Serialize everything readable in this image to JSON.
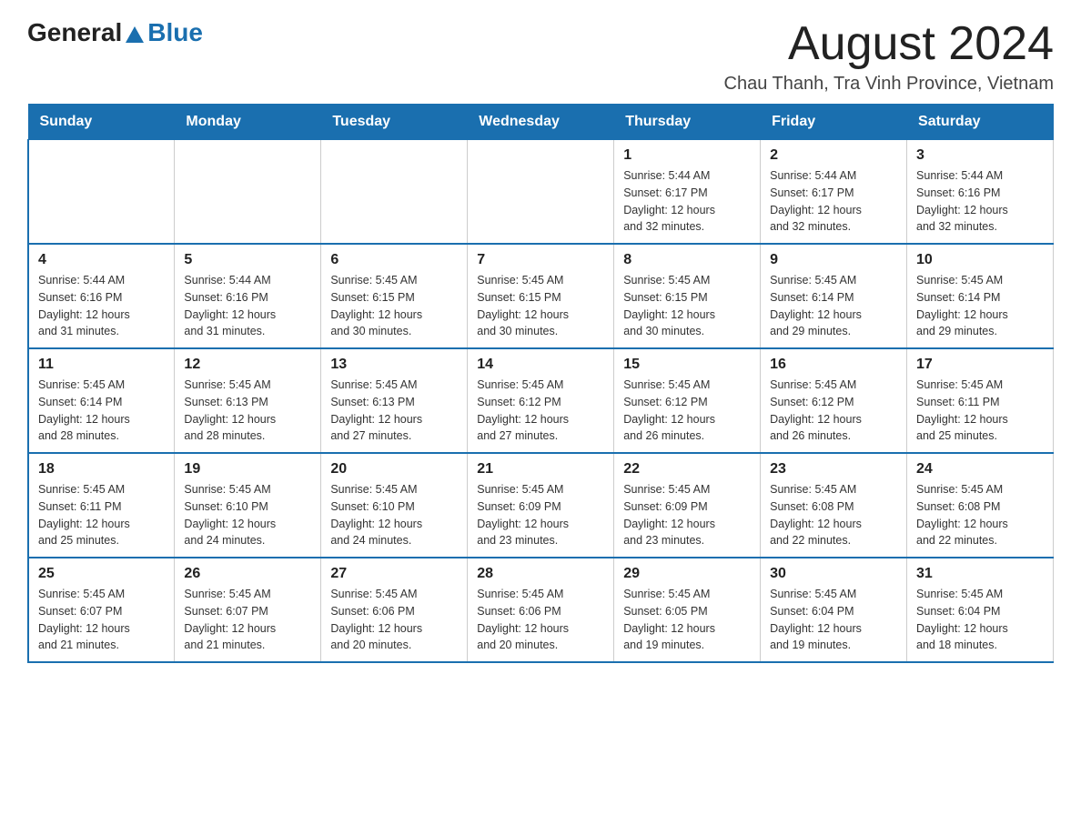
{
  "header": {
    "logo_general": "General",
    "logo_blue": "Blue",
    "title": "August 2024",
    "subtitle": "Chau Thanh, Tra Vinh Province, Vietnam"
  },
  "days_of_week": [
    "Sunday",
    "Monday",
    "Tuesday",
    "Wednesday",
    "Thursday",
    "Friday",
    "Saturday"
  ],
  "weeks": [
    {
      "days": [
        {
          "number": "",
          "info": ""
        },
        {
          "number": "",
          "info": ""
        },
        {
          "number": "",
          "info": ""
        },
        {
          "number": "",
          "info": ""
        },
        {
          "number": "1",
          "info": "Sunrise: 5:44 AM\nSunset: 6:17 PM\nDaylight: 12 hours\nand 32 minutes."
        },
        {
          "number": "2",
          "info": "Sunrise: 5:44 AM\nSunset: 6:17 PM\nDaylight: 12 hours\nand 32 minutes."
        },
        {
          "number": "3",
          "info": "Sunrise: 5:44 AM\nSunset: 6:16 PM\nDaylight: 12 hours\nand 32 minutes."
        }
      ]
    },
    {
      "days": [
        {
          "number": "4",
          "info": "Sunrise: 5:44 AM\nSunset: 6:16 PM\nDaylight: 12 hours\nand 31 minutes."
        },
        {
          "number": "5",
          "info": "Sunrise: 5:44 AM\nSunset: 6:16 PM\nDaylight: 12 hours\nand 31 minutes."
        },
        {
          "number": "6",
          "info": "Sunrise: 5:45 AM\nSunset: 6:15 PM\nDaylight: 12 hours\nand 30 minutes."
        },
        {
          "number": "7",
          "info": "Sunrise: 5:45 AM\nSunset: 6:15 PM\nDaylight: 12 hours\nand 30 minutes."
        },
        {
          "number": "8",
          "info": "Sunrise: 5:45 AM\nSunset: 6:15 PM\nDaylight: 12 hours\nand 30 minutes."
        },
        {
          "number": "9",
          "info": "Sunrise: 5:45 AM\nSunset: 6:14 PM\nDaylight: 12 hours\nand 29 minutes."
        },
        {
          "number": "10",
          "info": "Sunrise: 5:45 AM\nSunset: 6:14 PM\nDaylight: 12 hours\nand 29 minutes."
        }
      ]
    },
    {
      "days": [
        {
          "number": "11",
          "info": "Sunrise: 5:45 AM\nSunset: 6:14 PM\nDaylight: 12 hours\nand 28 minutes."
        },
        {
          "number": "12",
          "info": "Sunrise: 5:45 AM\nSunset: 6:13 PM\nDaylight: 12 hours\nand 28 minutes."
        },
        {
          "number": "13",
          "info": "Sunrise: 5:45 AM\nSunset: 6:13 PM\nDaylight: 12 hours\nand 27 minutes."
        },
        {
          "number": "14",
          "info": "Sunrise: 5:45 AM\nSunset: 6:12 PM\nDaylight: 12 hours\nand 27 minutes."
        },
        {
          "number": "15",
          "info": "Sunrise: 5:45 AM\nSunset: 6:12 PM\nDaylight: 12 hours\nand 26 minutes."
        },
        {
          "number": "16",
          "info": "Sunrise: 5:45 AM\nSunset: 6:12 PM\nDaylight: 12 hours\nand 26 minutes."
        },
        {
          "number": "17",
          "info": "Sunrise: 5:45 AM\nSunset: 6:11 PM\nDaylight: 12 hours\nand 25 minutes."
        }
      ]
    },
    {
      "days": [
        {
          "number": "18",
          "info": "Sunrise: 5:45 AM\nSunset: 6:11 PM\nDaylight: 12 hours\nand 25 minutes."
        },
        {
          "number": "19",
          "info": "Sunrise: 5:45 AM\nSunset: 6:10 PM\nDaylight: 12 hours\nand 24 minutes."
        },
        {
          "number": "20",
          "info": "Sunrise: 5:45 AM\nSunset: 6:10 PM\nDaylight: 12 hours\nand 24 minutes."
        },
        {
          "number": "21",
          "info": "Sunrise: 5:45 AM\nSunset: 6:09 PM\nDaylight: 12 hours\nand 23 minutes."
        },
        {
          "number": "22",
          "info": "Sunrise: 5:45 AM\nSunset: 6:09 PM\nDaylight: 12 hours\nand 23 minutes."
        },
        {
          "number": "23",
          "info": "Sunrise: 5:45 AM\nSunset: 6:08 PM\nDaylight: 12 hours\nand 22 minutes."
        },
        {
          "number": "24",
          "info": "Sunrise: 5:45 AM\nSunset: 6:08 PM\nDaylight: 12 hours\nand 22 minutes."
        }
      ]
    },
    {
      "days": [
        {
          "number": "25",
          "info": "Sunrise: 5:45 AM\nSunset: 6:07 PM\nDaylight: 12 hours\nand 21 minutes."
        },
        {
          "number": "26",
          "info": "Sunrise: 5:45 AM\nSunset: 6:07 PM\nDaylight: 12 hours\nand 21 minutes."
        },
        {
          "number": "27",
          "info": "Sunrise: 5:45 AM\nSunset: 6:06 PM\nDaylight: 12 hours\nand 20 minutes."
        },
        {
          "number": "28",
          "info": "Sunrise: 5:45 AM\nSunset: 6:06 PM\nDaylight: 12 hours\nand 20 minutes."
        },
        {
          "number": "29",
          "info": "Sunrise: 5:45 AM\nSunset: 6:05 PM\nDaylight: 12 hours\nand 19 minutes."
        },
        {
          "number": "30",
          "info": "Sunrise: 5:45 AM\nSunset: 6:04 PM\nDaylight: 12 hours\nand 19 minutes."
        },
        {
          "number": "31",
          "info": "Sunrise: 5:45 AM\nSunset: 6:04 PM\nDaylight: 12 hours\nand 18 minutes."
        }
      ]
    }
  ]
}
